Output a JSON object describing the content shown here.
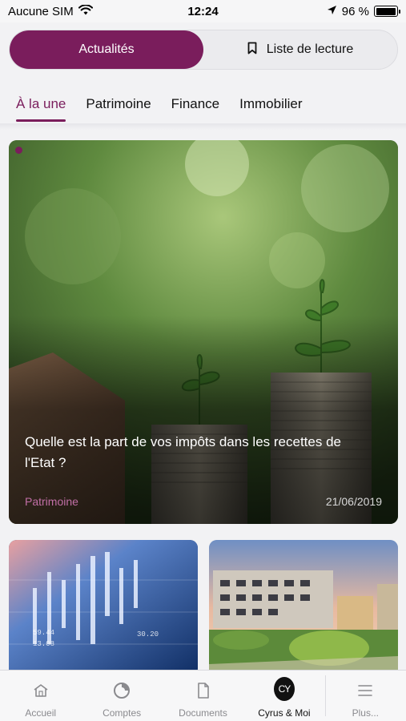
{
  "status_bar": {
    "carrier": "Aucune SIM",
    "time": "12:24",
    "battery": "96 %",
    "battery_level": 0.96,
    "icons": [
      "wifi-icon",
      "location-arrow-icon",
      "battery-icon"
    ]
  },
  "segmented": {
    "news_label": "Actualités",
    "reading_list_label": "Liste de lecture",
    "reading_list_icon": "bookmark-icon",
    "active_color": "#7a1d5c"
  },
  "tabs": [
    {
      "label": "À la une",
      "active": true
    },
    {
      "label": "Patrimoine",
      "active": false
    },
    {
      "label": "Finance",
      "active": false
    },
    {
      "label": "Immobilier",
      "active": false
    }
  ],
  "featured": {
    "title": "Quelle est la part de vos impôts dans les recettes de l'Etat ?",
    "category": "Patrimoine",
    "date": "21/06/2019",
    "image": "plants-growing-on-coin-stacks"
  },
  "cards": [
    {
      "image": "financial-market-chart"
    },
    {
      "image": "modern-residential-buildings"
    }
  ],
  "tabbar": {
    "items": [
      {
        "label": "Accueil",
        "icon": "home-icon",
        "active": false
      },
      {
        "label": "Comptes",
        "icon": "accounts-pie-icon",
        "active": false
      },
      {
        "label": "Documents",
        "icon": "document-icon",
        "active": false
      },
      {
        "label": "Cyrus & Moi",
        "icon": "cyrus-logo-icon",
        "badge": "CY",
        "active": true
      },
      {
        "label": "Plus...",
        "icon": "menu-lines-icon",
        "active": false
      }
    ]
  }
}
